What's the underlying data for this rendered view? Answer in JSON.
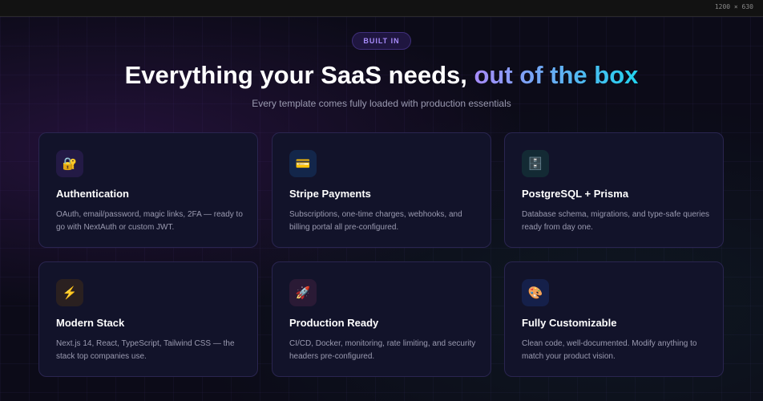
{
  "viewport_label": "1200 × 630",
  "badge": "BUILT IN",
  "heading": {
    "plain": "Everything your SaaS needs, ",
    "highlight": "out of the box"
  },
  "subtitle": "Every template comes fully loaded with production essentials",
  "features": [
    {
      "icon": "🔐",
      "icon_name": "lock-key-icon",
      "title": "Authentication",
      "desc": "OAuth, email/password, magic links, 2FA — ready to go with NextAuth or custom JWT."
    },
    {
      "icon": "💳",
      "icon_name": "credit-card-icon",
      "title": "Stripe Payments",
      "desc": "Subscriptions, one-time charges, webhooks, and billing portal all pre-configured."
    },
    {
      "icon": "🗄️",
      "icon_name": "database-icon",
      "title": "PostgreSQL + Prisma",
      "desc": "Database schema, migrations, and type-safe queries ready from day one."
    },
    {
      "icon": "⚡",
      "icon_name": "lightning-icon",
      "title": "Modern Stack",
      "desc": "Next.js 14, React, TypeScript, Tailwind CSS — the stack top companies use."
    },
    {
      "icon": "🚀",
      "icon_name": "rocket-icon",
      "title": "Production Ready",
      "desc": "CI/CD, Docker, monitoring, rate limiting, and security headers pre-configured."
    },
    {
      "icon": "🎨",
      "icon_name": "palette-icon",
      "title": "Fully Customizable",
      "desc": "Clean code, well-documented. Modify anything to match your product vision."
    }
  ]
}
